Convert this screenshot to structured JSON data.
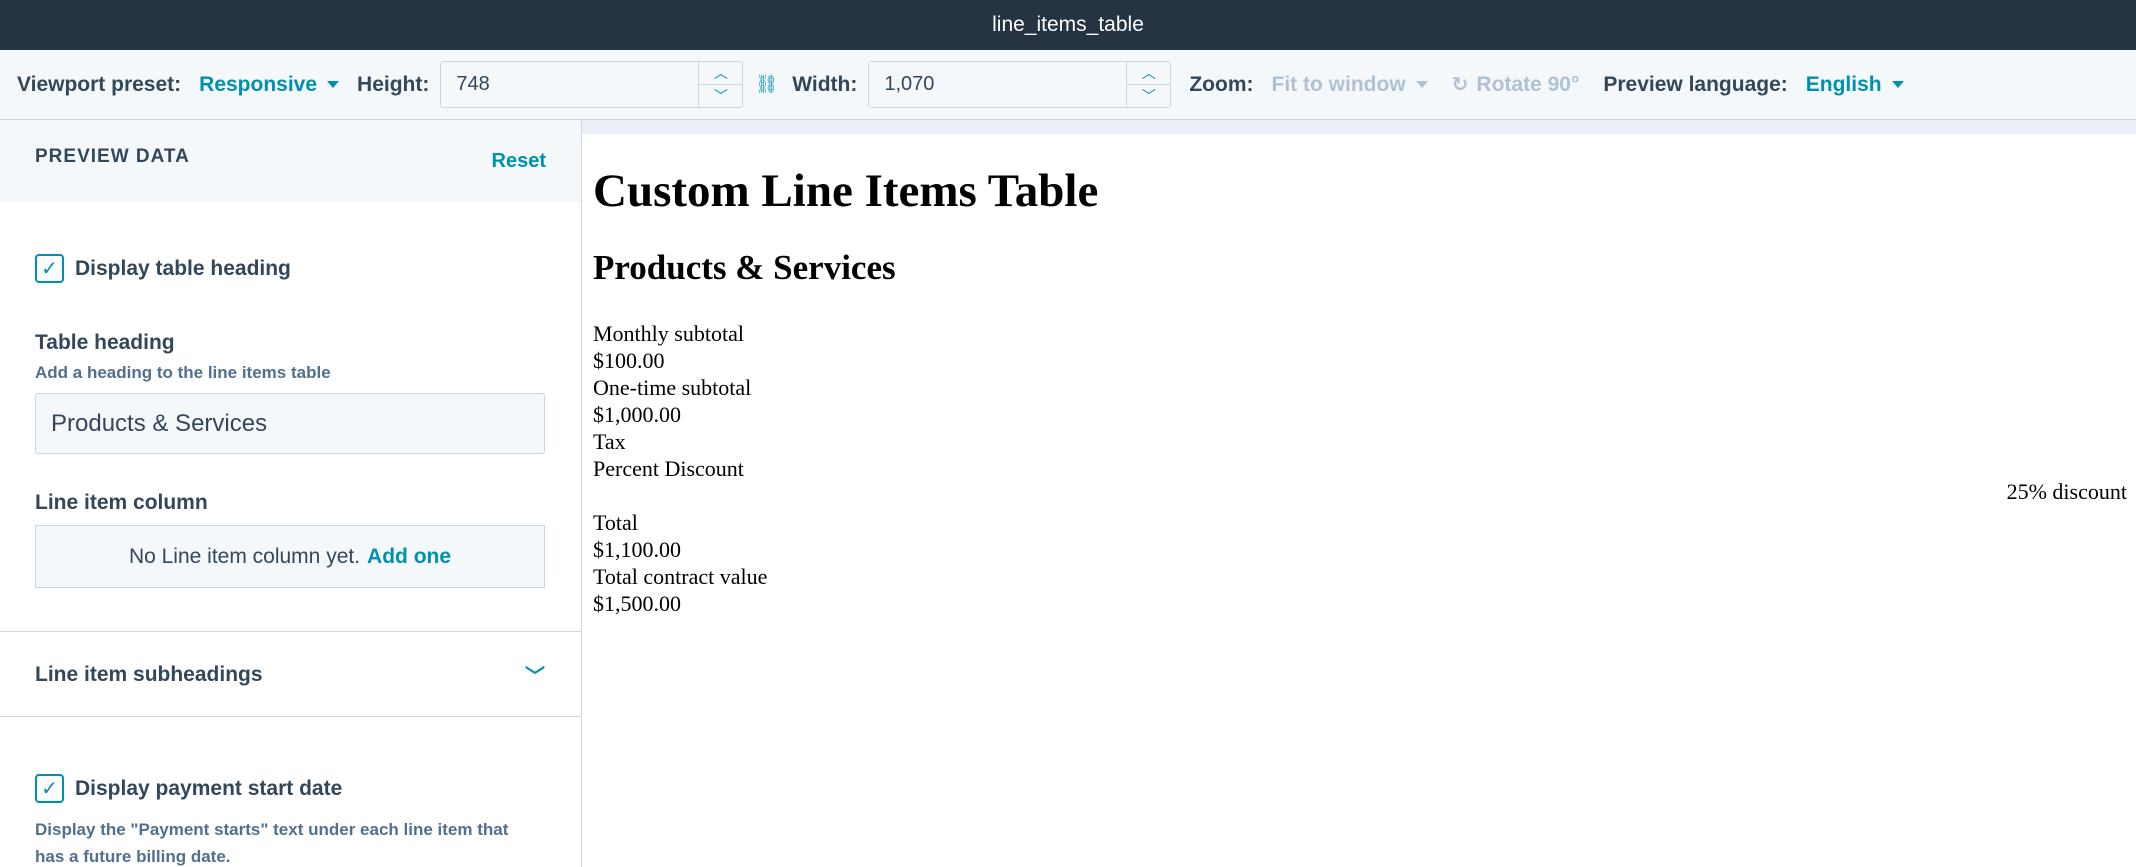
{
  "window": {
    "title": "line_items_table"
  },
  "toolbar": {
    "viewport_label": "Viewport preset:",
    "viewport_value": "Responsive",
    "height_label": "Height:",
    "height_value": "748",
    "width_label": "Width:",
    "width_value": "1,070",
    "zoom_label": "Zoom:",
    "zoom_value": "Fit to window",
    "rotate_label": "Rotate 90°",
    "language_label": "Preview language:",
    "language_value": "English"
  },
  "sidebar": {
    "header": "PREVIEW DATA",
    "reset": "Reset",
    "display_heading_label": "Display table heading",
    "display_heading_checked": true,
    "table_heading_label": "Table heading",
    "table_heading_help": "Add a heading to the line items table",
    "table_heading_value": "Products & Services",
    "line_item_column_label": "Line item column",
    "line_item_column_empty": "No Line item column yet.",
    "line_item_column_add": "Add one",
    "subheadings_label": "Line item subheadings",
    "payment_start_label": "Display payment start date",
    "payment_start_checked": true,
    "payment_start_help_1": "Display the \"Payment starts\" text under each line item that",
    "payment_start_help_2": "has a future billing date."
  },
  "preview": {
    "title": "Custom Line Items Table",
    "heading": "Products & Services",
    "lines": [
      "Monthly subtotal",
      "$100.00",
      "One-time subtotal",
      "$1,000.00",
      "Tax",
      "Percent Discount",
      "",
      "Total",
      "$1,100.00",
      "Total contract value",
      "$1,500.00"
    ],
    "discount_note": "25% discount"
  }
}
